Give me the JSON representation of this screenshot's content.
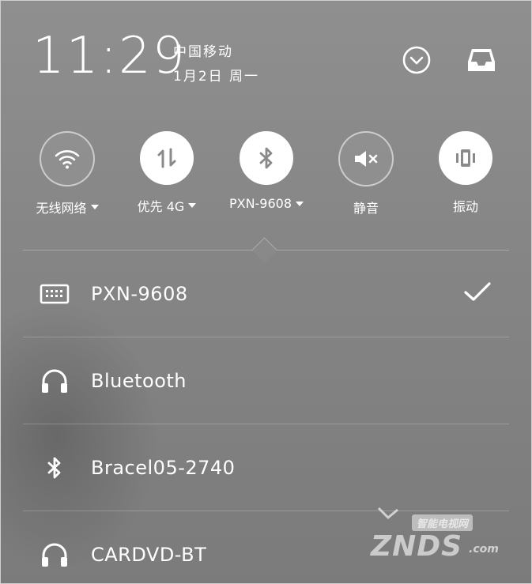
{
  "header": {
    "time": "11:29",
    "carrier": "中国移动",
    "date": "1月2日  周一"
  },
  "icons": {
    "expand": "chevron-down-circle-icon",
    "inbox": "notification-tray-icon"
  },
  "toggles": [
    {
      "label": "无线网络",
      "state": "off",
      "dropdown": true,
      "icon": "wifi-icon"
    },
    {
      "label": "优先 4G",
      "state": "on",
      "dropdown": true,
      "icon": "mobile-data-icon"
    },
    {
      "label": "PXN-9608",
      "state": "on",
      "dropdown": true,
      "icon": "bluetooth-icon"
    },
    {
      "label": "静音",
      "state": "off",
      "dropdown": false,
      "icon": "mute-icon"
    },
    {
      "label": "振动",
      "state": "on",
      "dropdown": false,
      "icon": "vibrate-icon"
    }
  ],
  "devices": [
    {
      "name": "PXN-9608",
      "icon": "keyboard-icon",
      "connected": true
    },
    {
      "name": "Bluetooth",
      "icon": "headphones-icon",
      "connected": false
    },
    {
      "name": "Bracel05-2740",
      "icon": "bluetooth-icon",
      "connected": false
    },
    {
      "name": "CARDVD-BT",
      "icon": "headphones-icon",
      "connected": false
    }
  ],
  "watermark": {
    "cn": "智能电视网",
    "main": "ZNDS",
    "suffix": ".com"
  },
  "colors": {
    "background": "#878787",
    "foreground": "#ffffff",
    "active_icon": "#8a8a8a"
  }
}
